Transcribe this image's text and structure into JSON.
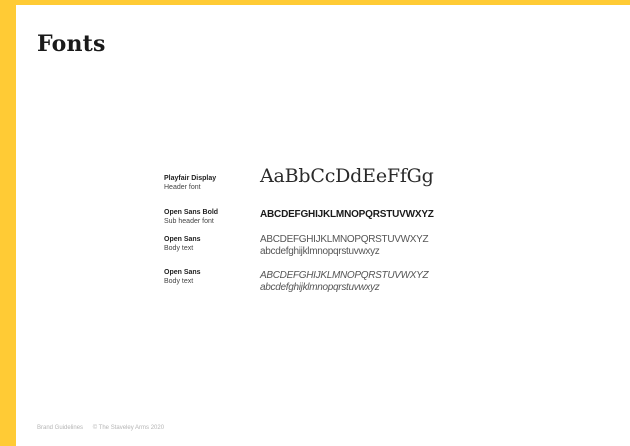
{
  "page": {
    "title": "Fonts",
    "accent_color": "#FFCB35"
  },
  "fonts": [
    {
      "name": "Playfair Display",
      "role": "Header font",
      "sample_lines": [
        "AaBbCcDdEeFfGg"
      ]
    },
    {
      "name": "Open Sans Bold",
      "role": "Sub header font",
      "sample_lines": [
        "ABCDEFGHIJKLMNOPQRSTUVWXYZ"
      ]
    },
    {
      "name": "Open Sans",
      "role": "Body text",
      "sample_lines": [
        "ABCDEFGHIJKLMNOPQRSTUVWXYZ",
        "abcdefghijklmnopqrstuvwxyz"
      ]
    },
    {
      "name": "Open Sans",
      "role": "Body text",
      "sample_lines": [
        "ABCDEFGHIJKLMNOPQRSTUVWXYZ",
        "abcdefghijklmnopqrstuvwxyz"
      ]
    }
  ],
  "footer": {
    "label": "Brand Guidelines",
    "copyright": "© The Staveley Arms 2020"
  }
}
